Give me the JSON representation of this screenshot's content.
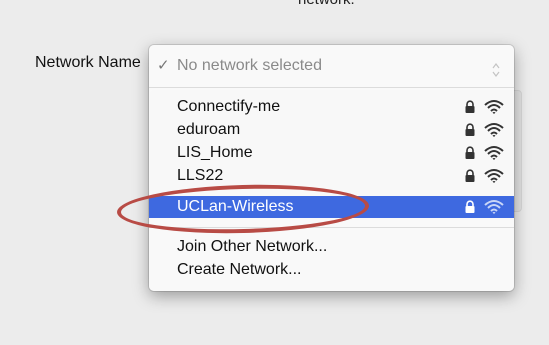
{
  "top_fragment": "network.",
  "network_name_label": "Network Name",
  "menu": {
    "selected_placeholder": "No network selected",
    "check_mark": "✓",
    "networks": [
      {
        "name": "Connectify-me",
        "secured": true
      },
      {
        "name": "eduroam",
        "secured": true
      },
      {
        "name": "LIS_Home",
        "secured": true
      },
      {
        "name": "LLS22",
        "secured": true
      },
      {
        "name": "UCLan-Wireless",
        "secured": true,
        "highlighted": true
      }
    ],
    "actions": {
      "join_other": "Join Other Network...",
      "create": "Create Network..."
    }
  },
  "colors": {
    "highlight": "#3e69e0",
    "annotation": "#b84b45"
  },
  "icons": [
    "lock-icon",
    "wifi-icon",
    "check-icon",
    "stepper-icon"
  ]
}
